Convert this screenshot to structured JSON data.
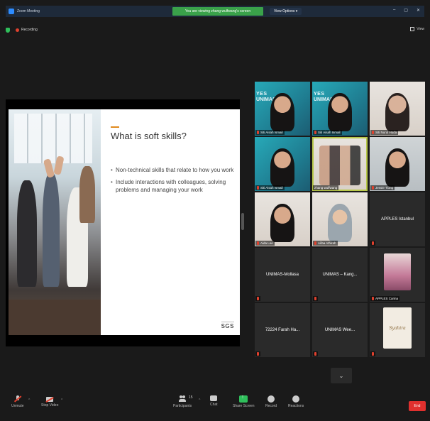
{
  "window": {
    "title": "Zoom Meeting",
    "share_banner": "You are viewing zhang wulfwang's screen",
    "view_options": "View Options"
  },
  "status": {
    "recording": "Recording",
    "view": "View"
  },
  "slide": {
    "heading": "What is soft skills?",
    "bullets": [
      "Non-technical skills that relate to how you work",
      "Include interactions with colleagues, solving problems and managing your work"
    ],
    "logo": "SGS"
  },
  "gallery": {
    "tiles": [
      {
        "name": "Siti Aisah Ismail",
        "banner": "YES",
        "banner2": "UNIMAS"
      },
      {
        "name": "Siti Aisah Ismail",
        "banner": "YES",
        "banner2": "UNIMAS"
      },
      {
        "name": "Siti Nurul Huda"
      },
      {
        "name": "Siti Aisah Ismail"
      },
      {
        "name": "zhang wulfwang"
      },
      {
        "name": "Jessie Tiong"
      },
      {
        "name": "Aida Lee"
      },
      {
        "name": "Aifaa Athirah"
      },
      {
        "name": "APPLES Istanbul"
      },
      {
        "name": "UNIMAS-Mollasa"
      },
      {
        "name": "UNIMAS – Kang..."
      },
      {
        "name": "APPLES Carina"
      },
      {
        "name": "72224 Farah Ha..."
      },
      {
        "name": "UNIMAS Wee..."
      },
      {
        "name": "Syahira"
      }
    ]
  },
  "toolbar": {
    "unmute": "Unmute",
    "stop_video": "Stop Video",
    "participants": "Participants",
    "participants_count": "15",
    "chat": "Chat",
    "share_screen": "Share Screen",
    "record": "Record",
    "reactions": "Reactions",
    "end": "End"
  },
  "icons": {
    "shield": "shield-icon",
    "recording": "record-dot-icon",
    "mic": "mic-off-icon",
    "video": "video-off-icon"
  },
  "colors": {
    "share_banner": "#3aa24a",
    "end_button": "#e0302e",
    "speaker_outline": "#b8c84a",
    "slide_accent": "#e08a1e"
  }
}
